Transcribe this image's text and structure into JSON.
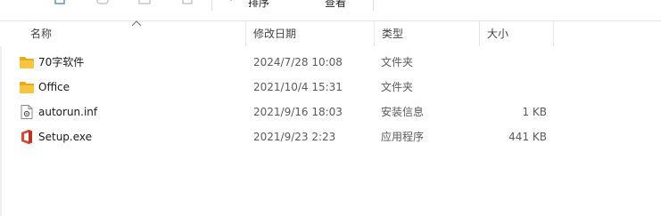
{
  "toolbar": {
    "sort_label": "排序",
    "view_label": "查看"
  },
  "columns": {
    "name": "名称",
    "modified": "修改日期",
    "type": "类型",
    "size": "大小"
  },
  "files": [
    {
      "name": "70字软件",
      "modified": "2024/7/28 10:08",
      "type": "文件夹",
      "size": "",
      "icon": "folder-icon"
    },
    {
      "name": "Office",
      "modified": "2021/10/4 15:31",
      "type": "文件夹",
      "size": "",
      "icon": "folder-icon"
    },
    {
      "name": "autorun.inf",
      "modified": "2021/9/16 18:03",
      "type": "安装信息",
      "size": "1 KB",
      "icon": "settings-file-icon"
    },
    {
      "name": "Setup.exe",
      "modified": "2021/9/23 2:23",
      "type": "应用程序",
      "size": "441 KB",
      "icon": "office-app-icon"
    }
  ],
  "colors": {
    "folder": "#F8C63D",
    "folder_dark": "#E8A91A",
    "office": "#E2442F"
  }
}
